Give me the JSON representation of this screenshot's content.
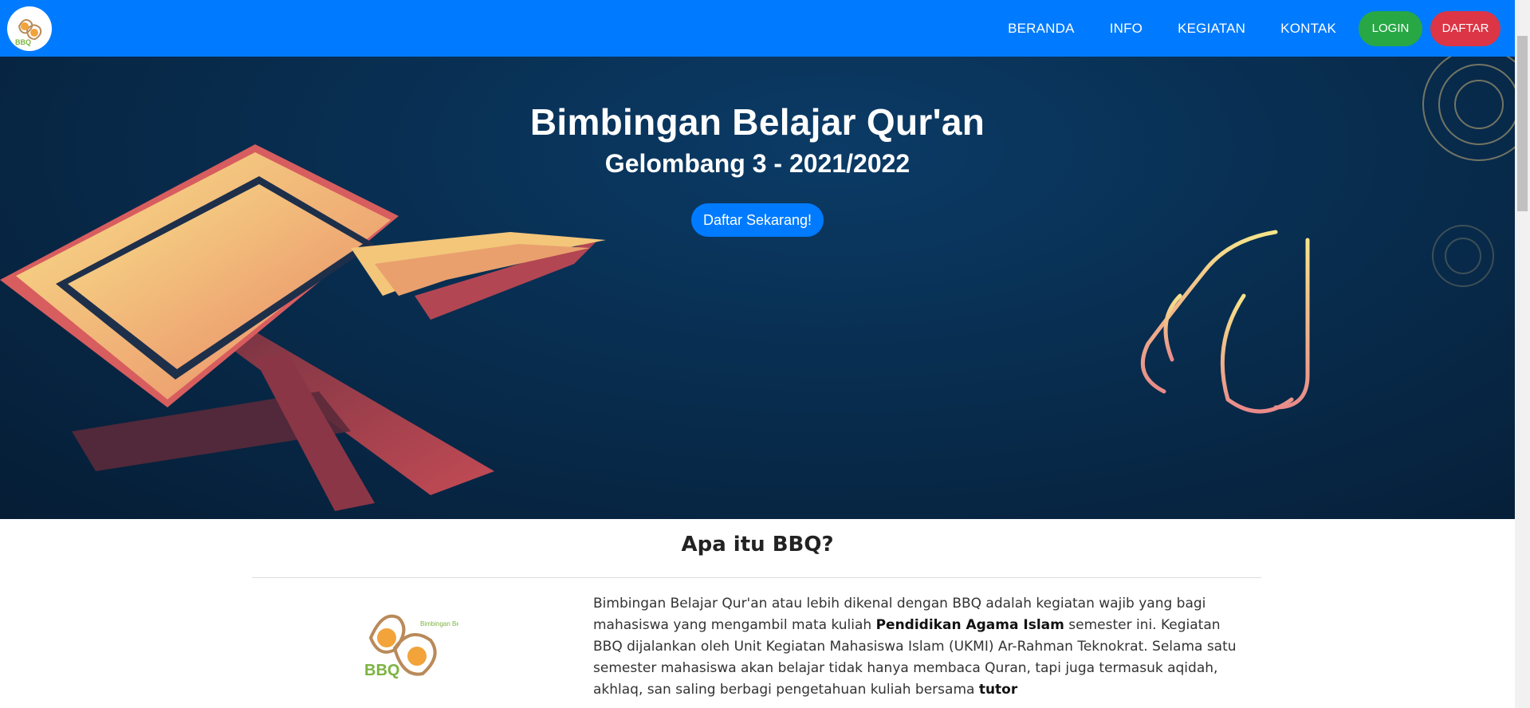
{
  "colors": {
    "primary": "#007bff",
    "login": "#28a745",
    "daftar": "#dc3545",
    "hero_bg": "#082d4f"
  },
  "nav": {
    "logo_icon": "bbq-logo-icon",
    "links": [
      "BERANDA",
      "INFO",
      "KEGIATAN",
      "KONTAK"
    ],
    "login_label": "LOGIN",
    "register_label": "DAFTAR"
  },
  "hero": {
    "title": "Bimbingan Belajar Qur'an",
    "subtitle": "Gelombang 3 - 2021/2022",
    "cta_label": "Daftar Sekarang!"
  },
  "about": {
    "title": "Apa itu BBQ?",
    "logo_caption": "Bimbingan Belajar Quran",
    "logo_letters": "BBQ",
    "paragraph": {
      "part1": "Bimbingan Belajar Qur'an atau lebih dikenal dengan BBQ adalah kegiatan wajib yang bagi mahasiswa yang mengambil mata kuliah ",
      "bold1": "Pendidikan Agama Islam",
      "part2": " semester ini. Kegiatan BBQ dijalankan oleh Unit Kegiatan Mahasiswa Islam (UKMI) Ar-Rahman Teknokrat. Selama satu semester mahasiswa akan belajar tidak hanya membaca Quran, tapi juga termasuk aqidah, akhlaq, san saling berbagi pengetahuan kuliah bersama ",
      "bold2": "tutor"
    }
  }
}
